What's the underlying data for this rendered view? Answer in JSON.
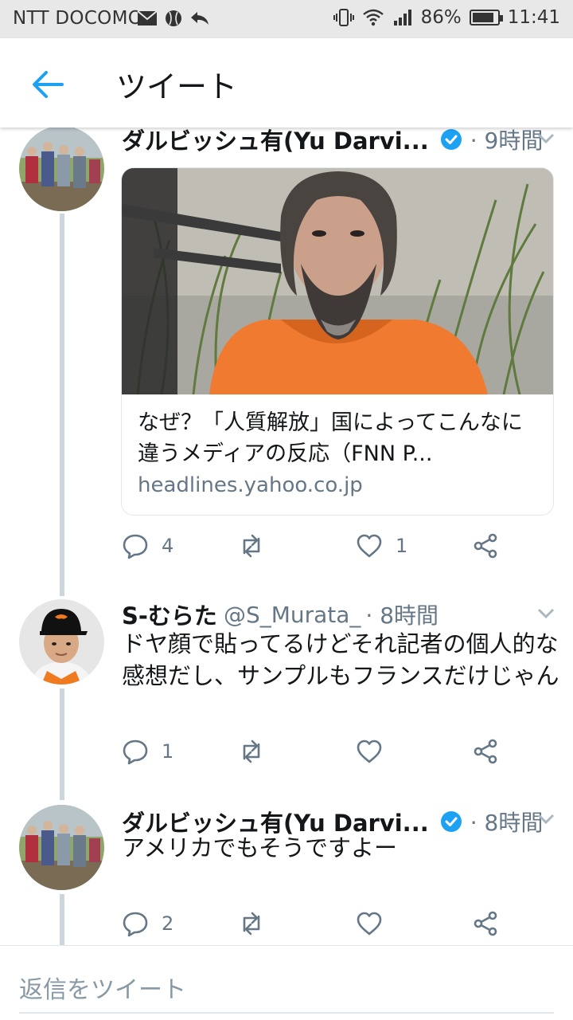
{
  "status_bar": {
    "carrier": "NTT DOCOMO",
    "battery": "86%",
    "battery_level": 0.86,
    "time": "11:41",
    "icons": [
      "mail-icon",
      "baseball-icon",
      "reply-arrow-icon",
      "vibrate-icon",
      "wifi-icon",
      "signal-icon",
      "battery-icon"
    ]
  },
  "app_bar": {
    "back_icon": "back-arrow-icon",
    "title": "ツイート"
  },
  "colors": {
    "accent": "#1da1f2",
    "secondary_text": "#657786",
    "thread_line": "#ccd6dd"
  },
  "tweets": [
    {
      "name": "ダルビッシュ有(Yu Darvi...",
      "verified": true,
      "time": "· 9時間",
      "card": {
        "title": "なぜ？「人質解放」国によってこんなに違うメディアの反応（FNN P...",
        "domain": "headlines.yahoo.co.jp"
      },
      "reply_count": "4",
      "like_count": "1"
    },
    {
      "name": "S-むらた",
      "handle": "@S_Murata_",
      "time": "· 8時間",
      "text": "ドヤ顔で貼ってるけどそれ記者の個人的な感想だし、サンプルもフランスだけじゃん",
      "reply_count": "1"
    },
    {
      "name": "ダルビッシュ有(Yu Darvi...",
      "verified": true,
      "time": "· 8時間",
      "text": "アメリカでもそうですよー",
      "reply_count": "2"
    }
  ],
  "reply_bar": {
    "placeholder": "返信をツイート"
  }
}
